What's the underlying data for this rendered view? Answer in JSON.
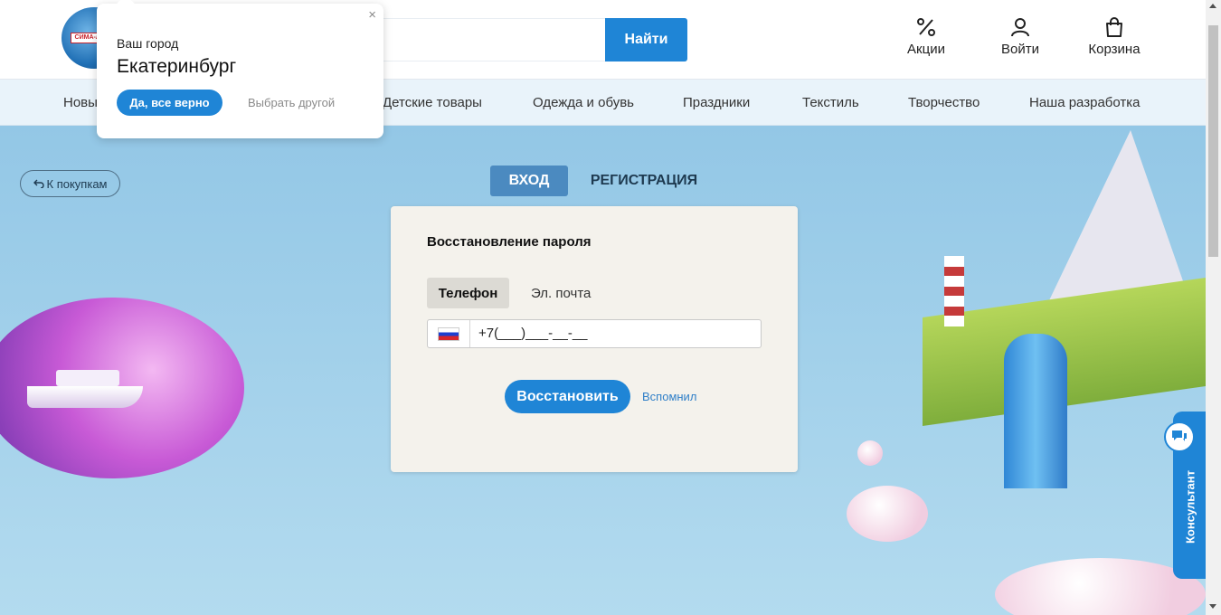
{
  "header": {
    "logo_text": "СИМА-ЛЕНД",
    "search_button": "Найти",
    "search_placeholder": "",
    "actions": [
      {
        "label": "Акции",
        "icon": "percent-icon"
      },
      {
        "label": "Войти",
        "icon": "user-icon"
      },
      {
        "label": "Корзина",
        "icon": "bag-icon"
      }
    ]
  },
  "nav": {
    "items": [
      "Новы",
      "Детские товары",
      "Одежда и обувь",
      "Праздники",
      "Текстиль",
      "Творчество",
      "Наша разработка"
    ]
  },
  "back_button": {
    "label": "К покупкам",
    "icon": "back-arrow-icon"
  },
  "auth_tabs": {
    "login": "ВХОД",
    "register": "РЕГИСТРАЦИЯ"
  },
  "recovery": {
    "title": "Восстановление пароля",
    "method_phone": "Телефон",
    "method_email": "Эл. почта",
    "phone_mask": "+7(___)___-__-__",
    "flag": "russia-flag-icon",
    "restore_button": "Восстановить",
    "remember_link": "Вспомнил"
  },
  "city_popup": {
    "label": "Ваш город",
    "city": "Екатеринбург",
    "confirm": "Да, все верно",
    "choose_other": "Выбрать другой",
    "close": "×"
  },
  "consultant": {
    "label": "Консультант",
    "icon": "chat-icon"
  },
  "colors": {
    "accent": "#1f85d6",
    "active_tab": "#4b8ac0",
    "card": "#f4f2ec"
  }
}
